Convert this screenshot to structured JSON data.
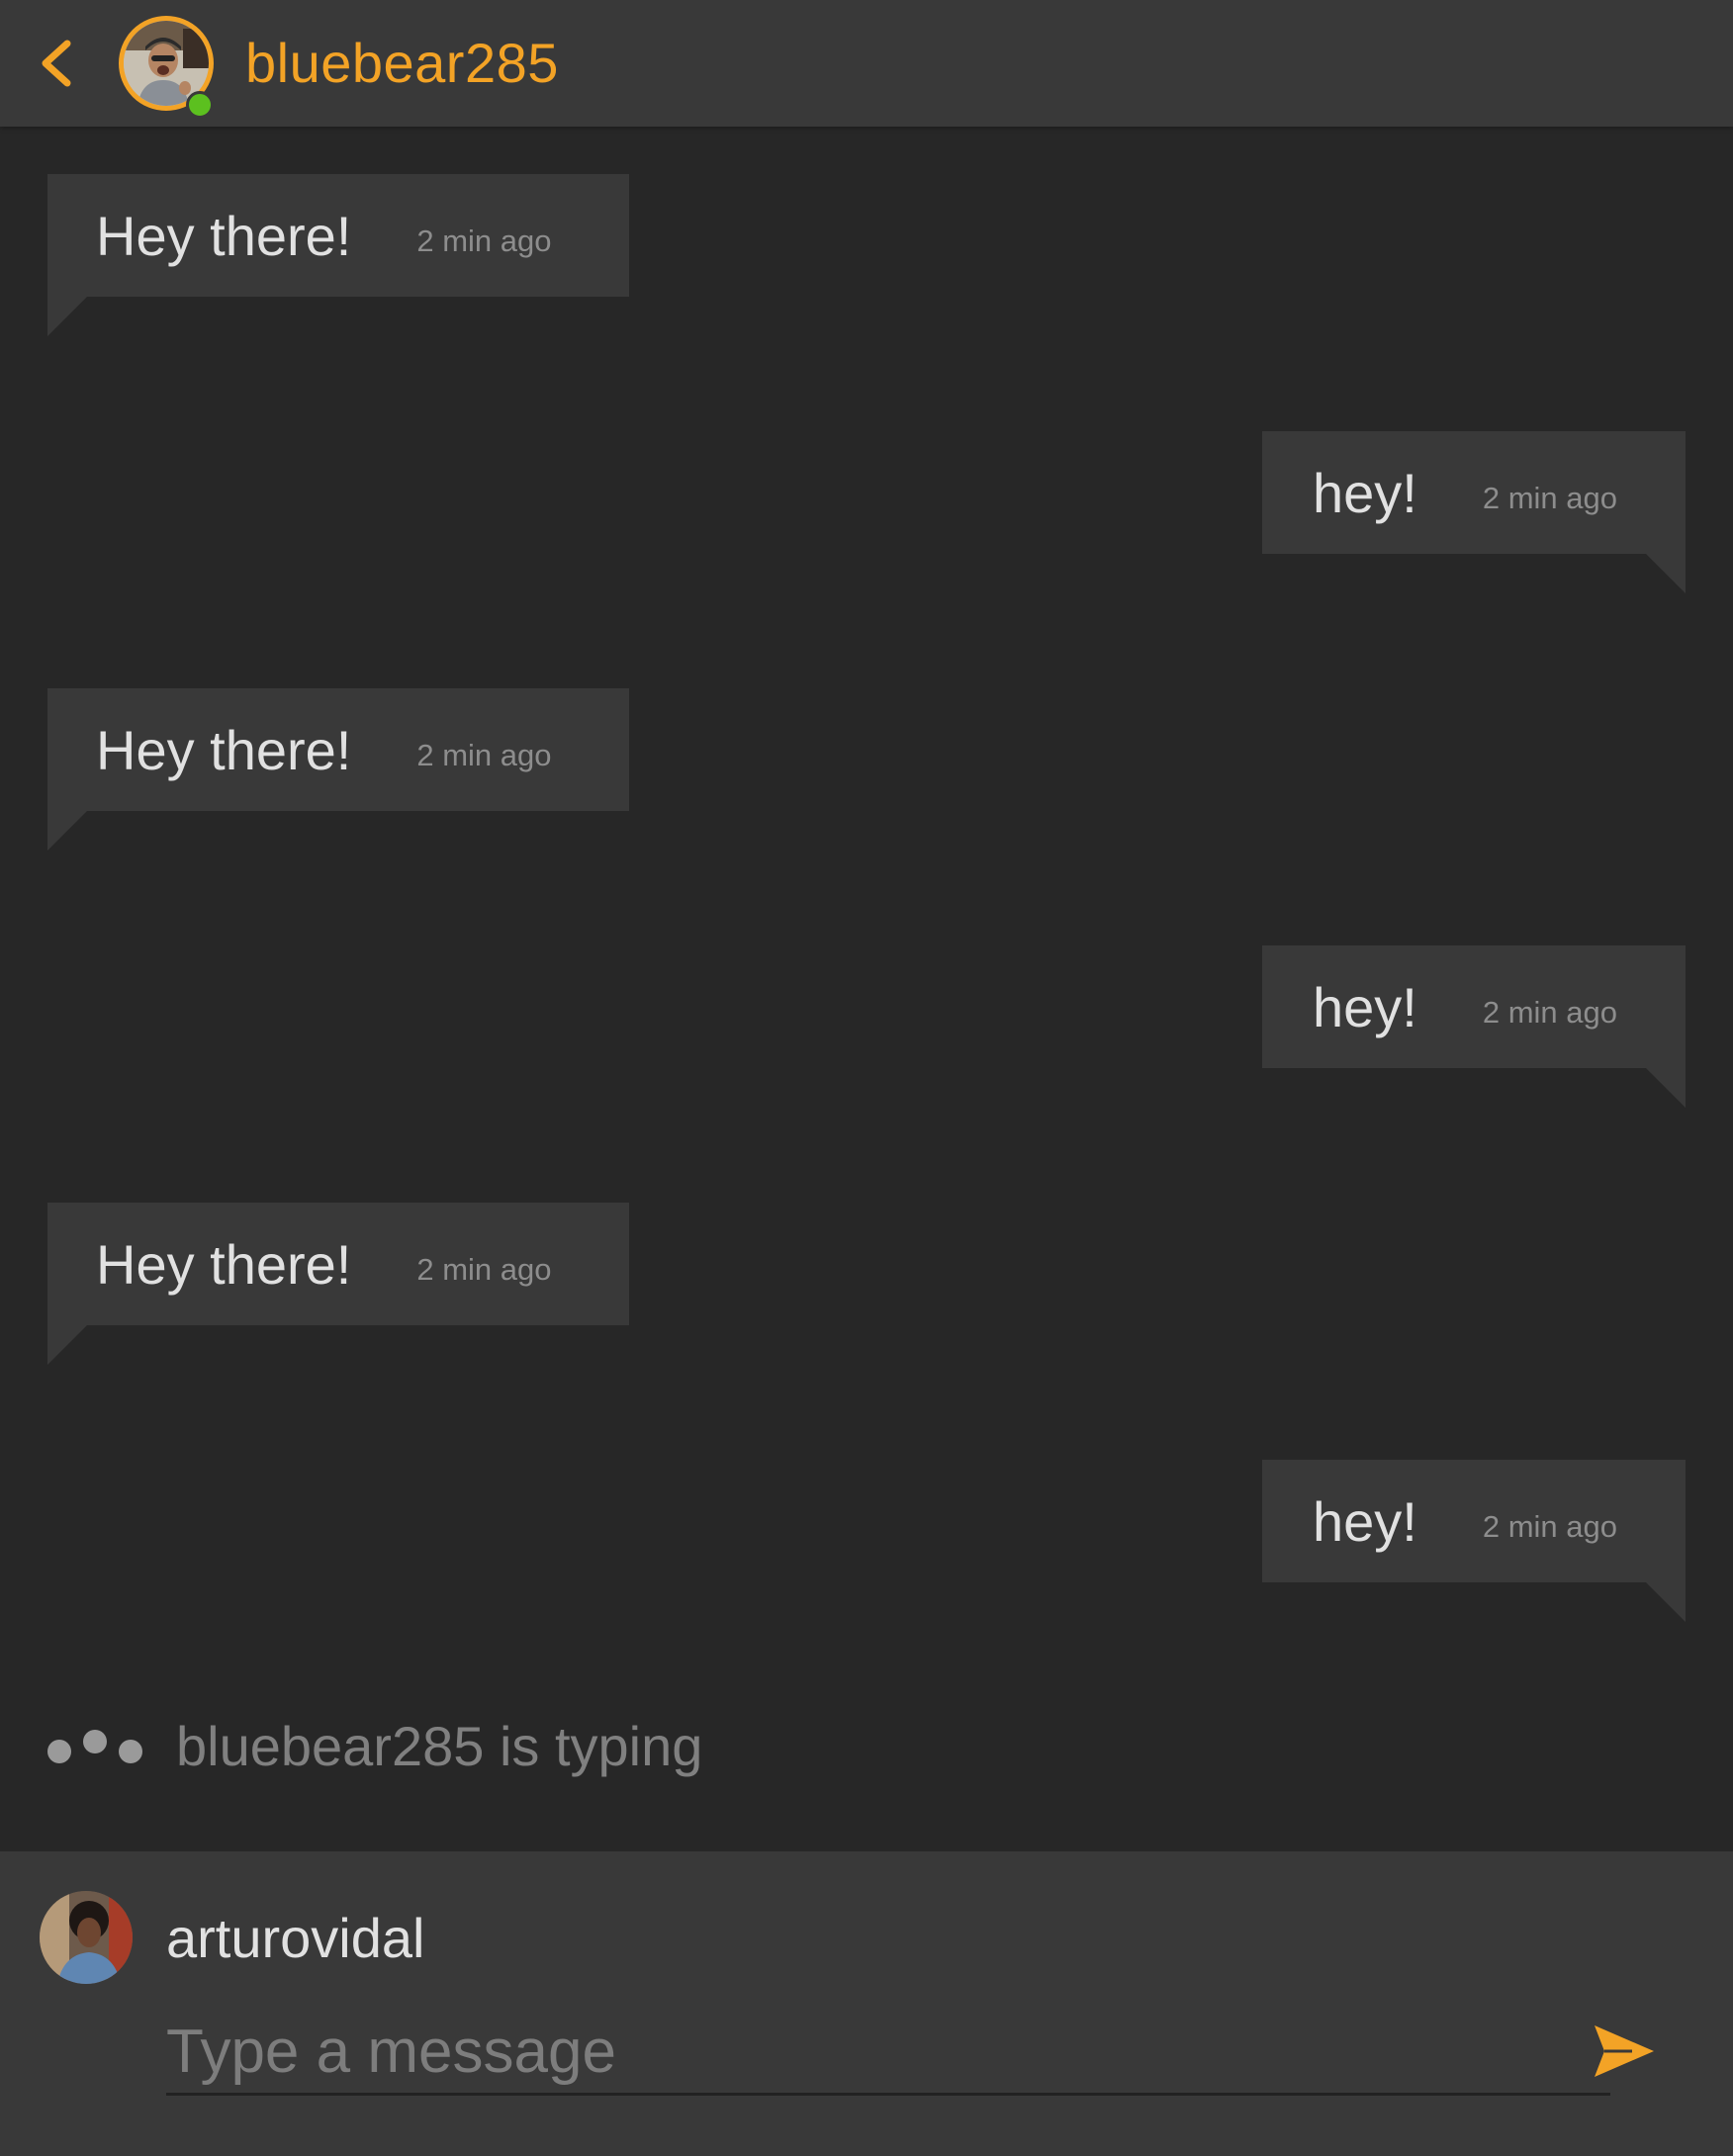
{
  "header": {
    "contact_name": "bluebear285",
    "back_icon": "chevron-left-icon",
    "online": true
  },
  "messages": [
    {
      "direction": "in",
      "text": "Hey there!",
      "time": "2 min ago"
    },
    {
      "direction": "out",
      "text": "hey!",
      "time": "2 min ago"
    },
    {
      "direction": "in",
      "text": "Hey there!",
      "time": "2 min ago"
    },
    {
      "direction": "out",
      "text": "hey!",
      "time": "2 min ago"
    },
    {
      "direction": "in",
      "text": "Hey there!",
      "time": "2 min ago"
    },
    {
      "direction": "out",
      "text": "hey!",
      "time": "2 min ago"
    }
  ],
  "typing": {
    "text": "bluebear285 is typing"
  },
  "composer": {
    "user_name": "arturovidal",
    "value": "",
    "placeholder": "Type a message",
    "send_icon": "send-icon"
  },
  "colors": {
    "accent": "#f3a326",
    "background": "#272727",
    "panel": "#393939",
    "online": "#5cc01f"
  }
}
